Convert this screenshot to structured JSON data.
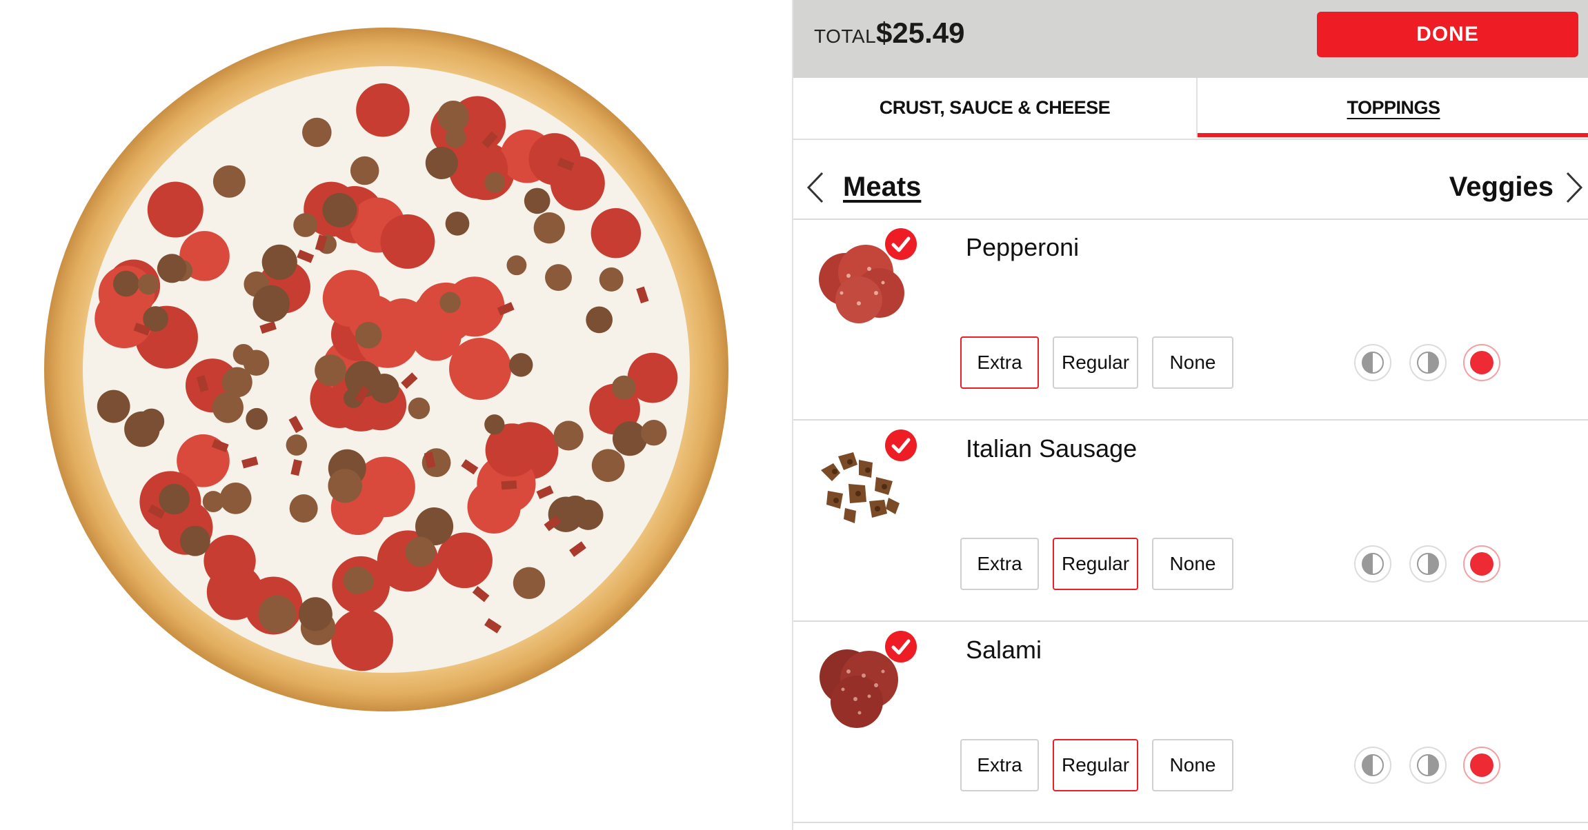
{
  "summary": {
    "total_label": "TOTAL",
    "total_value": "$25.49",
    "done_label": "DONE"
  },
  "tabs": [
    {
      "label": "CRUST, SAUCE & CHEESE",
      "active": false
    },
    {
      "label": "TOPPINGS",
      "active": true
    }
  ],
  "category_nav": {
    "current": "Meats",
    "next": "Veggies"
  },
  "toppings": [
    {
      "name": "Pepperoni",
      "selected": true,
      "amount_options": [
        "Extra",
        "Regular",
        "None"
      ],
      "amount": "Extra",
      "placement": "whole"
    },
    {
      "name": "Italian Sausage",
      "selected": true,
      "amount_options": [
        "Extra",
        "Regular",
        "None"
      ],
      "amount": "Regular",
      "placement": "whole"
    },
    {
      "name": "Salami",
      "selected": true,
      "amount_options": [
        "Extra",
        "Regular",
        "None"
      ],
      "amount": "Regular",
      "placement": "whole"
    }
  ],
  "colors": {
    "accent": "#ee1c25",
    "header_bg": "#d4d4d2",
    "crust": "#e2b56a",
    "sauce": "#d8453a"
  },
  "icons": [
    "chevron-left-icon",
    "chevron-right-icon",
    "checkmark-icon",
    "left-half-icon",
    "right-half-icon",
    "whole-pizza-icon"
  ]
}
